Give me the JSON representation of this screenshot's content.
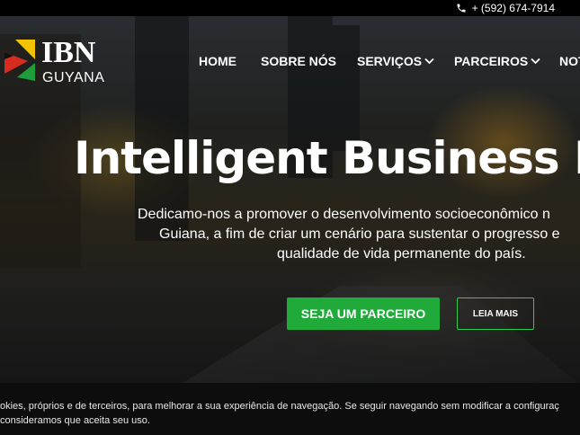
{
  "topbar": {
    "phone_icon": "phone-icon",
    "phone": "+ (592) 674-7914"
  },
  "logo": {
    "title": "IBN",
    "subtitle": "GUYANA",
    "colors": {
      "red": "#d62b1f",
      "yellow": "#f2c400",
      "green": "#1e9e3a",
      "black": "#111111"
    }
  },
  "nav": {
    "items": [
      {
        "label": "HOME",
        "has_dropdown": false
      },
      {
        "label": "SOBRE NÓS",
        "has_dropdown": false
      },
      {
        "label": "SERVIÇOS",
        "has_dropdown": true
      },
      {
        "label": "PARCEIROS",
        "has_dropdown": true
      },
      {
        "label": "NOT",
        "has_dropdown": false
      }
    ]
  },
  "hero": {
    "headline": "Intelligent Business N",
    "subtitle_lines": [
      "Dedicamo-nos a promover o desenvolvimento socioeconômico n",
      "Guiana, a fim de criar um cenário para sustentar o progresso e",
      "qualidade de vida permanente do país."
    ],
    "primary_button": "SEJA UM PARCEIRO",
    "secondary_button": "LEIA MAIS"
  },
  "cookie": {
    "line1": "okies, próprios e de terceiros, para melhorar a sua experiência de navegação. Se seguir navegando sem modificar a configuraç",
    "line2": " consideramos que aceita seu uso."
  },
  "colors": {
    "accent_green": "#1faa3a",
    "outline_green": "#2ecc50",
    "topbar": "#000000",
    "cookie_bg": "#0d0d0d"
  }
}
